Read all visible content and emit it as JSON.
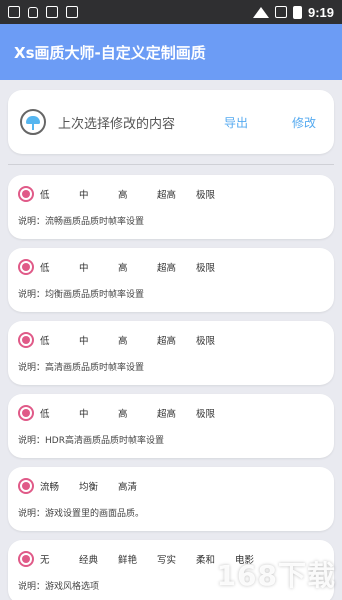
{
  "status_bar": {
    "time": "9:19"
  },
  "app_bar": {
    "title": "Xs画质大师-自定义定制画质"
  },
  "top_card": {
    "title": "上次选择修改的内容",
    "export_label": "导出",
    "modify_label": "修改"
  },
  "cards": [
    {
      "options": [
        "低",
        "中",
        "高",
        "超高",
        "极限"
      ],
      "description": "说明：流畅画质品质时帧率设置"
    },
    {
      "options": [
        "低",
        "中",
        "高",
        "超高",
        "极限"
      ],
      "description": "说明：均衡画质品质时帧率设置"
    },
    {
      "options": [
        "低",
        "中",
        "高",
        "超高",
        "极限"
      ],
      "description": "说明：高清画质品质时帧率设置"
    },
    {
      "options": [
        "低",
        "中",
        "高",
        "超高",
        "极限"
      ],
      "description": "说明：HDR高清画质品质时帧率设置"
    },
    {
      "options": [
        "流畅",
        "均衡",
        "高清"
      ],
      "description": "说明：游戏设置里的画面品质。"
    },
    {
      "options": [
        "无",
        "经典",
        "鲜艳",
        "写实",
        "柔和",
        "电影"
      ],
      "description": "说明：游戏风格选项"
    }
  ],
  "watermark": "168下载",
  "colors": {
    "app_bar": "#6c9cf5",
    "accent": "#e05a88",
    "link": "#55aaf0"
  }
}
